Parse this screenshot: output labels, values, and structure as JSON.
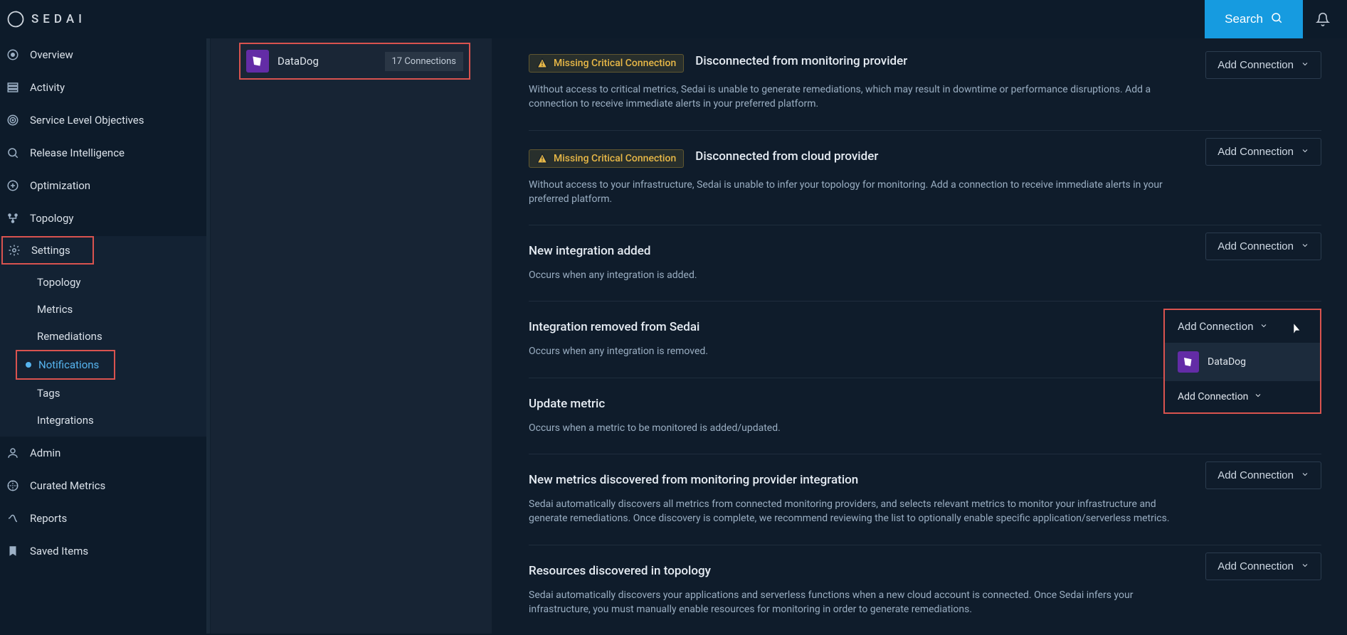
{
  "app": {
    "name": "SEDAI"
  },
  "topbar": {
    "search_label": "Search"
  },
  "sidebar": {
    "items": [
      {
        "label": "Overview"
      },
      {
        "label": "Activity"
      },
      {
        "label": "Service Level Objectives"
      },
      {
        "label": "Release Intelligence"
      },
      {
        "label": "Optimization"
      },
      {
        "label": "Topology"
      },
      {
        "label": "Settings",
        "sub": [
          {
            "label": "Topology"
          },
          {
            "label": "Metrics"
          },
          {
            "label": "Remediations"
          },
          {
            "label": "Notifications",
            "active": true
          },
          {
            "label": "Tags"
          },
          {
            "label": "Integrations"
          }
        ]
      },
      {
        "label": "Admin"
      },
      {
        "label": "Curated Metrics"
      },
      {
        "label": "Reports"
      },
      {
        "label": "Saved Items"
      }
    ]
  },
  "integration": {
    "name": "DataDog",
    "connections_text": "17 Connections"
  },
  "dropdown": {
    "add_label": "Add Connection",
    "option_label": "DataDog"
  },
  "notifications": {
    "add_button": "Add Connection",
    "missing_label": "Missing Critical Connection",
    "rows": [
      {
        "warn": true,
        "title": "Disconnected from monitoring provider",
        "desc": "Without access to critical metrics, Sedai is unable to generate remediations, which may result in downtime or performance disruptions. Add a connection to receive immediate alerts in your preferred platform."
      },
      {
        "warn": true,
        "title": "Disconnected from cloud provider",
        "desc": "Without access to your infrastructure, Sedai is unable to infer your topology for monitoring. Add a connection to receive immediate alerts in your preferred platform."
      },
      {
        "warn": false,
        "title": "New integration added",
        "desc": "Occurs when any integration is added."
      },
      {
        "warn": false,
        "title": "Integration removed from Sedai",
        "desc": "Occurs when any integration is removed."
      },
      {
        "warn": false,
        "title": "Update metric",
        "desc": "Occurs when a metric to be monitored is added/updated."
      },
      {
        "warn": false,
        "title": "New metrics discovered from monitoring provider integration",
        "desc": "Sedai automatically discovers all metrics from connected monitoring providers, and selects relevant metrics to monitor your infrastructure and generate remediations. Once discovery is complete, we recommend reviewing the list to optionally enable specific application/serverless metrics."
      },
      {
        "warn": false,
        "title": "Resources discovered in topology",
        "desc": "Sedai automatically discovers your applications and serverless functions when a new cloud account is connected. Once Sedai infers your infrastructure, you must manually enable resources for monitoring in order to generate remediations."
      }
    ]
  }
}
